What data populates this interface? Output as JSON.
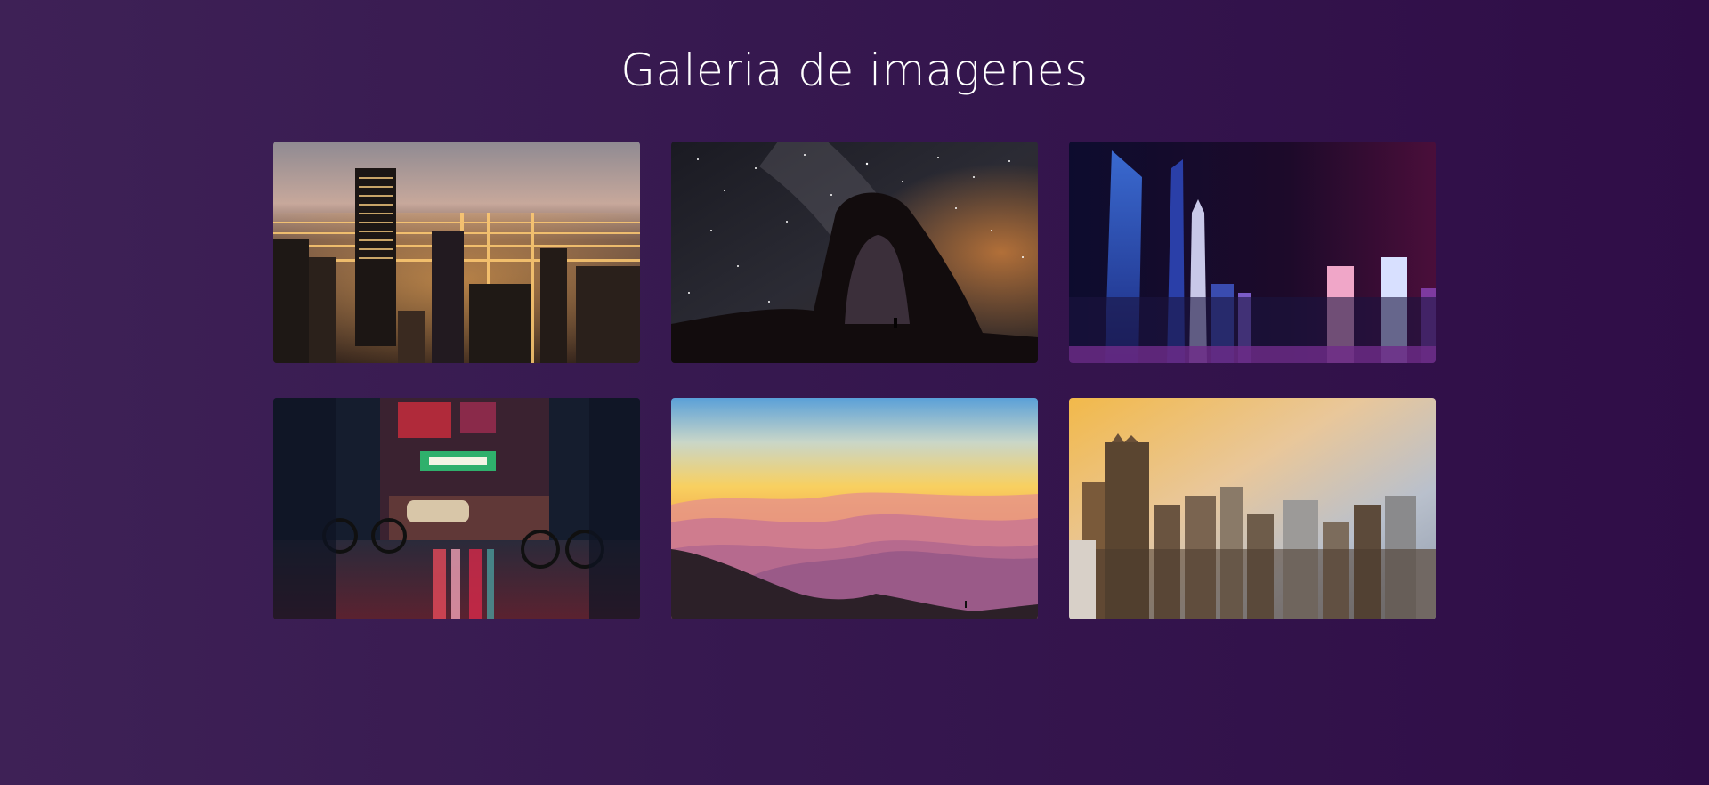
{
  "page": {
    "title": "Galeria de imagenes"
  },
  "gallery": {
    "images": [
      {
        "subject": "city lights skyline at dusk"
      },
      {
        "subject": "rock arch under milky way night sky"
      },
      {
        "subject": "neon skyscrapers at night"
      },
      {
        "subject": "neon-lit street at night with cyclist and taxi"
      },
      {
        "subject": "layered mountains at sunset"
      },
      {
        "subject": "city skyline at golden hour"
      }
    ]
  },
  "colors": {
    "background_start": "#3e2156",
    "background_end": "#2f0d47",
    "title": "#ffffff"
  }
}
